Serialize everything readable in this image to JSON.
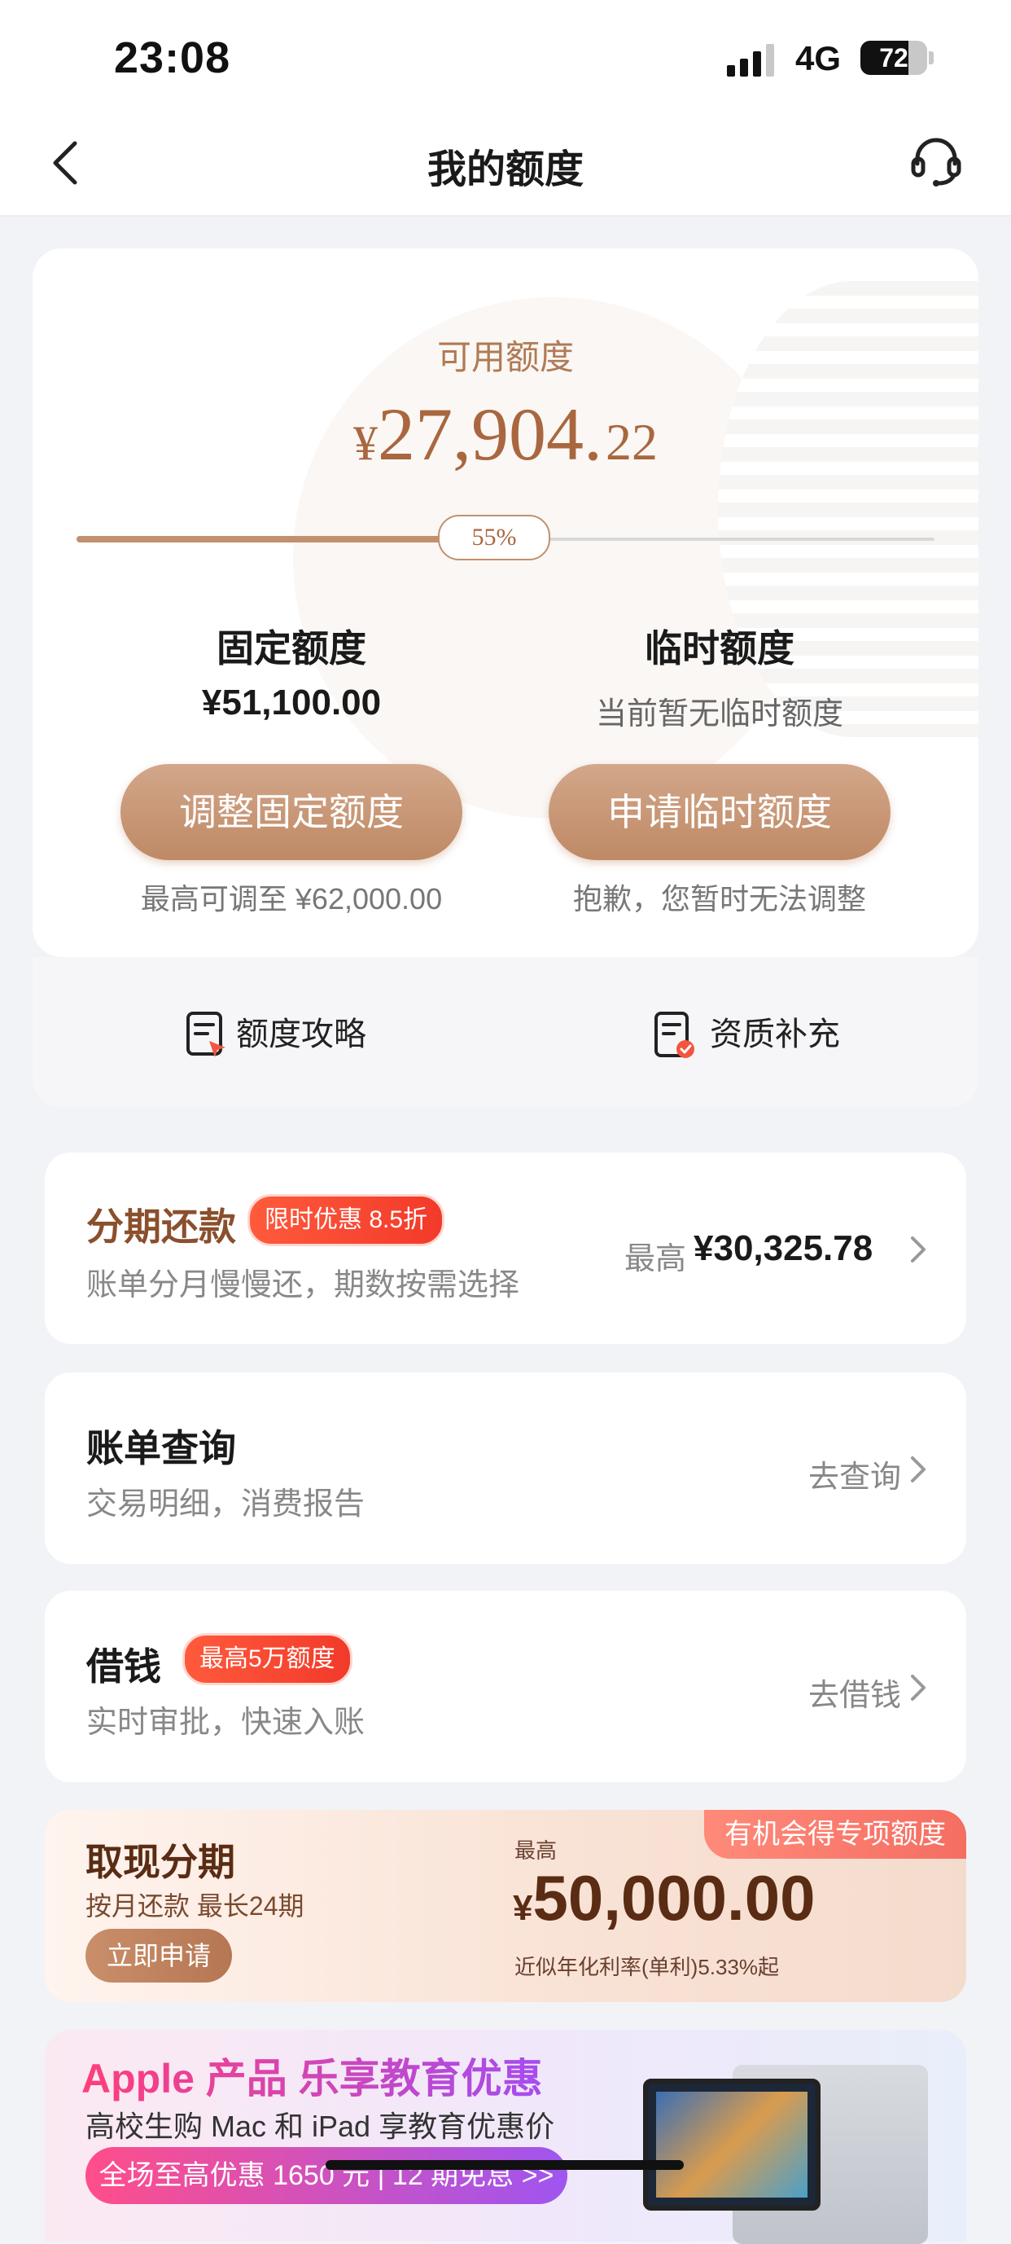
{
  "status": {
    "time": "23:08",
    "network": "4G",
    "battery": "72"
  },
  "nav": {
    "title": "我的额度"
  },
  "credit": {
    "available_label": "可用额度",
    "currency": "¥",
    "amount_int": "27,904.",
    "amount_dec": "22",
    "progress_label": "55%",
    "progress": 0.55,
    "fixed_label": "固定额度",
    "fixed_value": "¥51,100.00",
    "temp_label": "临时额度",
    "temp_value": "当前暂无临时额度",
    "fixed_button": "调整固定额度",
    "temp_button": "申请临时额度",
    "fixed_note": "最高可调至 ¥62,000.00",
    "temp_note": "抱歉，您暂时无法调整",
    "tool_guide": "额度攻略",
    "tool_qualify": "资质补充"
  },
  "installment": {
    "title": "分期还款",
    "badge": "限时优惠 8.5折",
    "subtitle": "账单分月慢慢还，期数按需选择",
    "right_prefix": "最高",
    "right_value": "¥30,325.78"
  },
  "bill": {
    "title": "账单查询",
    "subtitle": "交易明细，消费报告",
    "action": "去查询"
  },
  "borrow": {
    "title": "借钱",
    "badge": "最高5万额度",
    "subtitle": "实时审批，快速入账",
    "action": "去借钱"
  },
  "cash": {
    "tag": "有机会得专项额度",
    "title": "取现分期",
    "subtitle": "按月还款 最长24期",
    "button": "立即申请",
    "max_label": "最高",
    "currency": "¥",
    "amount": "50,000.00",
    "rate": "近似年化利率(单利)5.33%起"
  },
  "promo": {
    "title": "Apple 产品 乐享教育优惠",
    "subtitle": "高校生购 Mac 和 iPad 享教育优惠价",
    "pill": "全场至高优惠 1650 元 | 12 期免息 >>"
  },
  "colors": {
    "accent": "#a9673f",
    "badge": "#f23a2a"
  }
}
